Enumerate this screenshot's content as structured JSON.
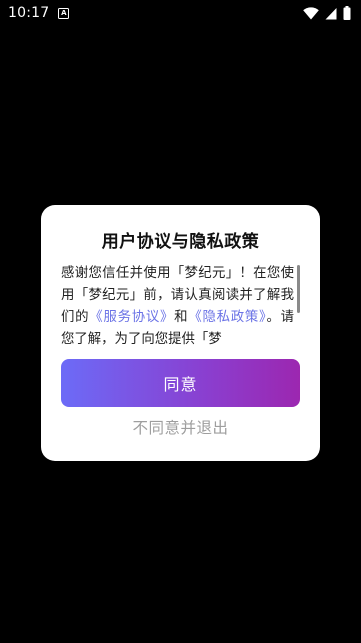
{
  "status_bar": {
    "time": "10:17",
    "notification_glyph": "A",
    "icons": [
      "wifi-icon",
      "signal-icon",
      "battery-icon"
    ]
  },
  "dialog": {
    "title": "用户协议与隐私政策",
    "body": {
      "before_links": "感谢您信任并使用「梦纪元」！在您使用「梦纪元」前，请认真阅读并了解我们的",
      "service_link": "《服务协议》",
      "conjunction": "和",
      "privacy_link": "《隐私政策》",
      "after_links": "。请您了解，为了向您提供「梦"
    },
    "agree_label": "同意",
    "decline_label": "不同意并退出"
  },
  "colors": {
    "background": "#000000",
    "dialog_bg": "#ffffff",
    "link": "#6b73e6",
    "button_gradient_start": "#6c6bf7",
    "button_gradient_end": "#9c27b0",
    "decline_text": "#9e9e9e"
  }
}
